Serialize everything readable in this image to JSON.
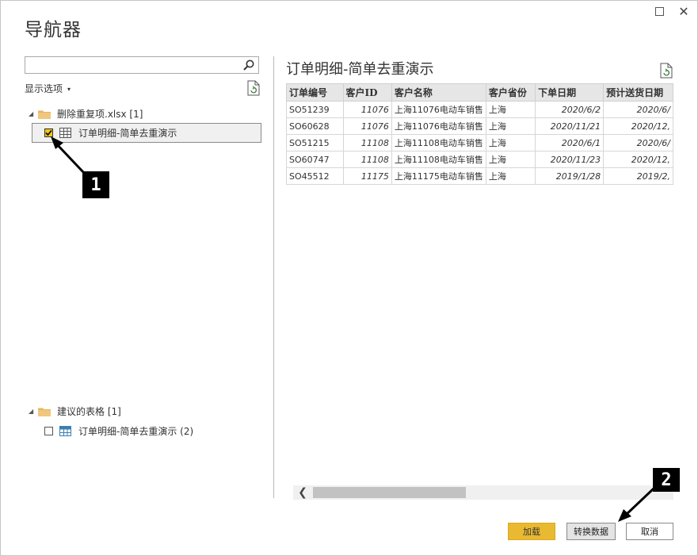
{
  "window": {
    "title": "导航器",
    "maximize_icon": "maximize-icon",
    "close_icon": "close-icon",
    "close_glyph": "✕"
  },
  "left_panel": {
    "search": {
      "value": "",
      "placeholder": "",
      "icon": "search-icon"
    },
    "display_options": {
      "label": "显示选项",
      "caret": "▾"
    },
    "refresh_icon": "refresh-icon",
    "folders": [
      {
        "label": "删除重复项.xlsx [1]",
        "expanded_glyph": "◢",
        "items": [
          {
            "label": "订单明细-简单去重演示",
            "checked": true
          }
        ]
      },
      {
        "label": "建议的表格 [1]",
        "expanded_glyph": "◢",
        "items": [
          {
            "label": "订单明细-简单去重演示 (2)",
            "checked": false
          }
        ]
      }
    ]
  },
  "preview": {
    "title": "订单明细-简单去重演示",
    "refresh_icon": "refresh-icon",
    "columns": [
      "订单编号",
      "客户ID",
      "客户名称",
      "客户省份",
      "下单日期",
      "预计送货日期"
    ],
    "rows": [
      [
        "SO51239",
        "11076",
        "上海11076电动车销售",
        "上海",
        "2020/6/2",
        "2020/6/"
      ],
      [
        "SO60628",
        "11076",
        "上海11076电动车销售",
        "上海",
        "2020/11/21",
        "2020/12,"
      ],
      [
        "SO51215",
        "11108",
        "上海11108电动车销售",
        "上海",
        "2020/6/1",
        "2020/6/"
      ],
      [
        "SO60747",
        "11108",
        "上海11108电动车销售",
        "上海",
        "2020/11/23",
        "2020/12,"
      ],
      [
        "SO45512",
        "11175",
        "上海11175电动车销售",
        "上海",
        "2019/1/28",
        "2019/2,"
      ]
    ],
    "scroll_left_glyph": "❮"
  },
  "footer": {
    "load_label": "加载",
    "transform_label": "转换数据",
    "cancel_label": "取消"
  },
  "annotations": {
    "marker_1": "1",
    "marker_2": "2"
  },
  "colors": {
    "accent_yellow": "#E8B931",
    "check_yellow": "#F2C811",
    "folder": "#E7B563",
    "table_icon_blue": "#3C7FB1"
  }
}
